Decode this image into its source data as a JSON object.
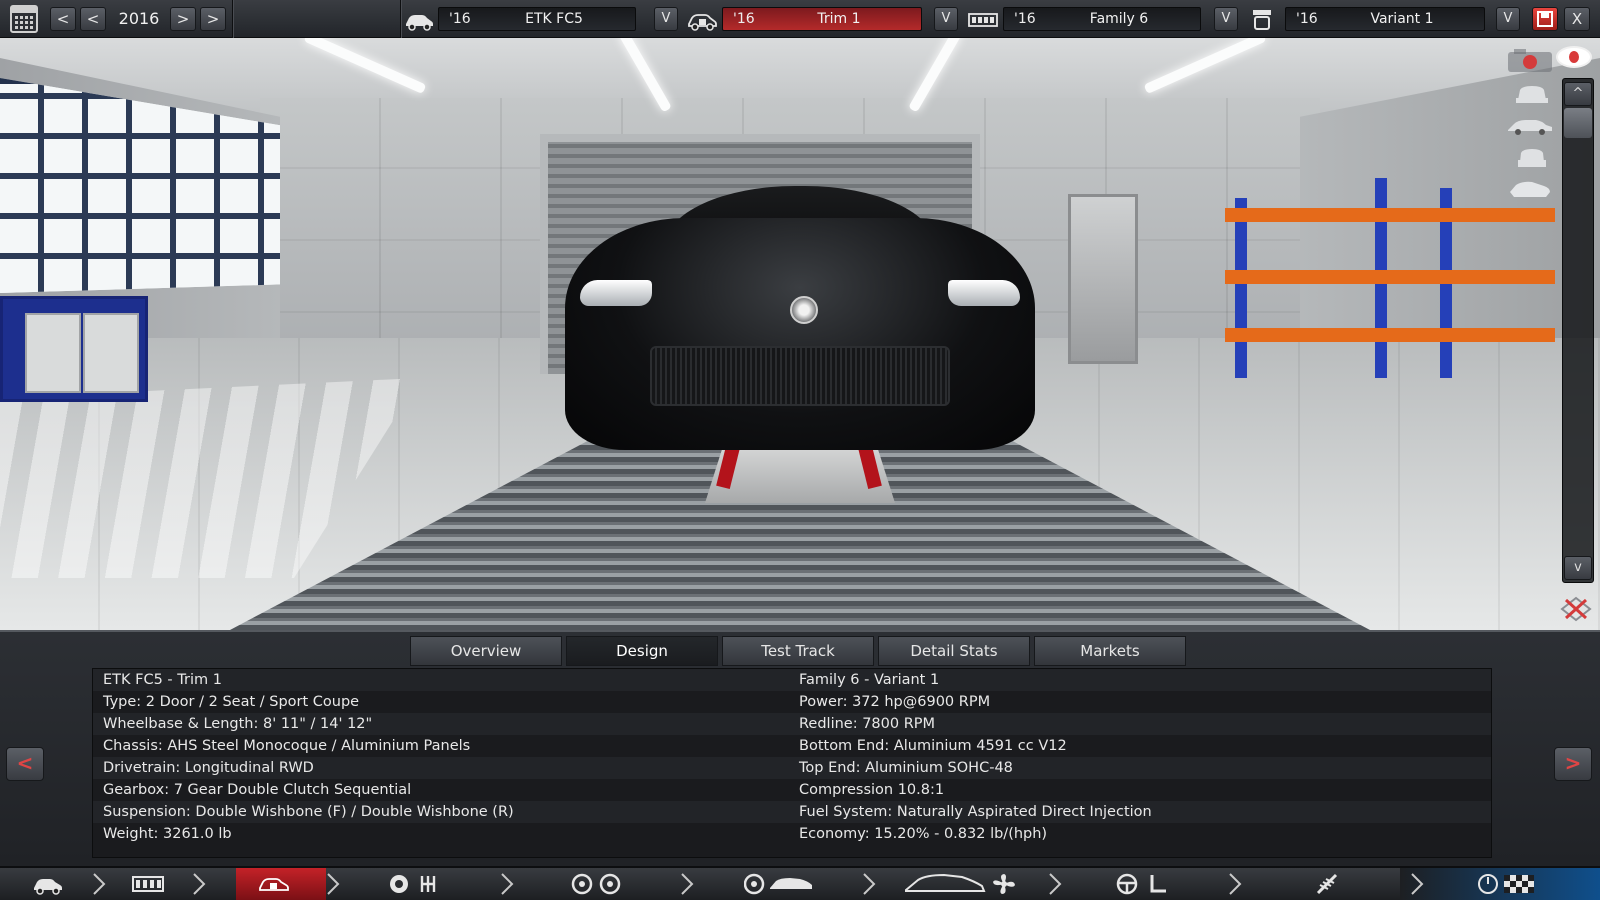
{
  "topbar": {
    "year": "2016",
    "selectors": [
      {
        "id": "model",
        "year": "'16",
        "name": "ETK FC5",
        "icon": "car-model-icon"
      },
      {
        "id": "trim",
        "year": "'16",
        "name": "Trim 1",
        "icon": "car-trim-icon"
      },
      {
        "id": "family",
        "year": "'16",
        "name": "Family 6",
        "icon": "engine-family-icon"
      },
      {
        "id": "variant",
        "year": "'16",
        "name": "Variant 1",
        "icon": "engine-variant-icon"
      }
    ],
    "dropdown_glyph": "V",
    "prev_glyph": "<",
    "next_glyph": ">",
    "close_glyph": "X"
  },
  "viewport": {
    "scroll_up_glyph": "^",
    "scroll_down_glyph": "v"
  },
  "tabs": [
    {
      "label": "Overview",
      "active": false
    },
    {
      "label": "Design",
      "active": true
    },
    {
      "label": "Test Track",
      "active": false
    },
    {
      "label": "Detail Stats",
      "active": false
    },
    {
      "label": "Markets",
      "active": false
    }
  ],
  "info": {
    "left": [
      "ETK FC5 - Trim 1",
      "Type: 2 Door / 2 Seat / Sport Coupe",
      "Wheelbase & Length: 8' 11\" / 14' 12\"",
      "Chassis: AHS Steel Monocoque / Aluminium Panels",
      "Drivetrain: Longitudinal RWD",
      "Gearbox: 7 Gear Double Clutch Sequential",
      "Suspension: Double Wishbone (F) / Double Wishbone (R)",
      "Weight: 3261.0 lb"
    ],
    "right": [
      "Family 6 - Variant 1",
      "Power: 372 hp@6900 RPM",
      "Redline: 7800 RPM",
      "Bottom End: Aluminium 4591 cc V12",
      "Top End: Aluminium SOHC-48",
      "Compression 10.8:1",
      "Fuel System: Naturally Aspirated Direct Injection",
      "Economy: 15.20% - 0.832 lb/(hph)"
    ],
    "prev_glyph": "<",
    "next_glyph": ">"
  },
  "bottomnav": [
    {
      "name": "model-stage",
      "icon": "car-model-icon"
    },
    {
      "name": "chassis-stage",
      "icon": "chassis-icon"
    },
    {
      "name": "trim-stage",
      "icon": "car-trim-icon",
      "active": true
    },
    {
      "name": "engine-gearbox-stage",
      "icon": "gear-icon"
    },
    {
      "name": "wheels-stage",
      "icon": "wheels-icon"
    },
    {
      "name": "body-stage",
      "icon": "car-body-icon"
    },
    {
      "name": "aero-cooling-stage",
      "icon": "fan-icon"
    },
    {
      "name": "interior-stage",
      "icon": "steering-wheel-icon"
    },
    {
      "name": "suspension-stage",
      "icon": "spring-icon"
    },
    {
      "name": "test-stage",
      "icon": "checkered-flag-icon"
    }
  ],
  "colors": {
    "accent_red": "#c42228",
    "active_tab": "#1a1c1f",
    "panel_bg": "#202226",
    "nav_blue": "#0f4f8c"
  }
}
